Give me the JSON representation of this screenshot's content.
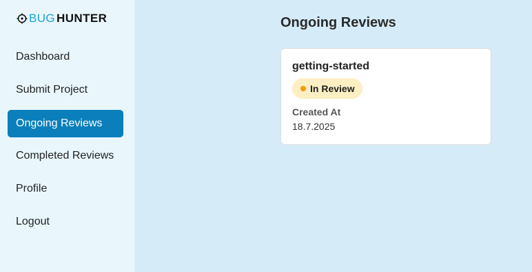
{
  "brand": {
    "part1": "BUG",
    "part2": "HUNTER",
    "icon": "crosshair-icon",
    "accent_color": "#1aa3d4"
  },
  "sidebar": {
    "items": [
      {
        "label": "Dashboard",
        "active": false
      },
      {
        "label": "Submit Project",
        "active": false
      },
      {
        "label": "Ongoing Reviews",
        "active": true
      },
      {
        "label": "Completed Reviews",
        "active": false
      },
      {
        "label": "Profile",
        "active": false
      },
      {
        "label": "Logout",
        "active": false
      }
    ],
    "active_color": "#0a7fbb"
  },
  "main": {
    "title": "Ongoing Reviews",
    "reviews": [
      {
        "name": "getting-started",
        "status": "In Review",
        "status_color": "#f29d0b",
        "created_label": "Created At",
        "created_value": "18.7.2025"
      }
    ]
  }
}
